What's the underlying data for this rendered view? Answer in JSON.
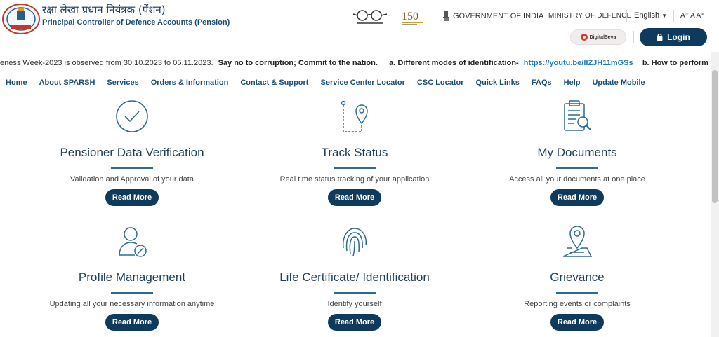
{
  "header": {
    "org_hindi": "रक्षा लेखा प्रधान नियंत्रक (पेंशन)",
    "org_english": "Principal Controller of Defence Accounts (Pension)",
    "government": "GOVERNMENT OF INDIA",
    "ministry": "MINISTRY OF DEFENCE",
    "language": "English",
    "font_size_controls": "A⁻ A A⁺",
    "digital_seva": "DigitalSeva",
    "login": "Login",
    "anniversary": "150"
  },
  "ticker": {
    "text1": "eness Week-2023 is observed from 30.10.2023 to 05.11.2023.",
    "text2": "Say no to corruption; Commit to the nation.",
    "text3": "a. Different modes of identification-",
    "link1": "https://youtu.be/lIZJH11mGSs",
    "text4": "b. How to perform identification thr"
  },
  "nav": {
    "items": [
      "Home",
      "About SPARSH",
      "Services",
      "Orders & Information",
      "Contact & Support",
      "Service Center Locator",
      "CSC Locator",
      "Quick Links",
      "FAQs",
      "Help",
      "Update Mobile"
    ]
  },
  "cards": [
    {
      "title": "Pensioner Data Verification",
      "desc": "Validation and Approval of your data",
      "button": "Read More",
      "icon": "check-circle-icon"
    },
    {
      "title": "Track Status",
      "desc": "Real time status tracking of your application",
      "button": "Read More",
      "icon": "route-pin-icon"
    },
    {
      "title": "My Documents",
      "desc": "Access all your documents at one place",
      "button": "Read More",
      "icon": "clipboard-search-icon"
    },
    {
      "title": "Profile Management",
      "desc": "Updating all your necessary information anytime",
      "button": "Read More",
      "icon": "user-edit-icon"
    },
    {
      "title": "Life Certificate/ Identification",
      "desc": "Identify yourself",
      "button": "Read More",
      "icon": "fingerprint-icon"
    },
    {
      "title": "Grievance",
      "desc": "Reporting events or complaints",
      "button": "Read More",
      "icon": "map-pin-icon"
    }
  ],
  "colors": {
    "primary": "#0e3a5d",
    "icon": "#2c6b94",
    "link": "#1e7bc4",
    "nav": "#1a4e7a"
  }
}
